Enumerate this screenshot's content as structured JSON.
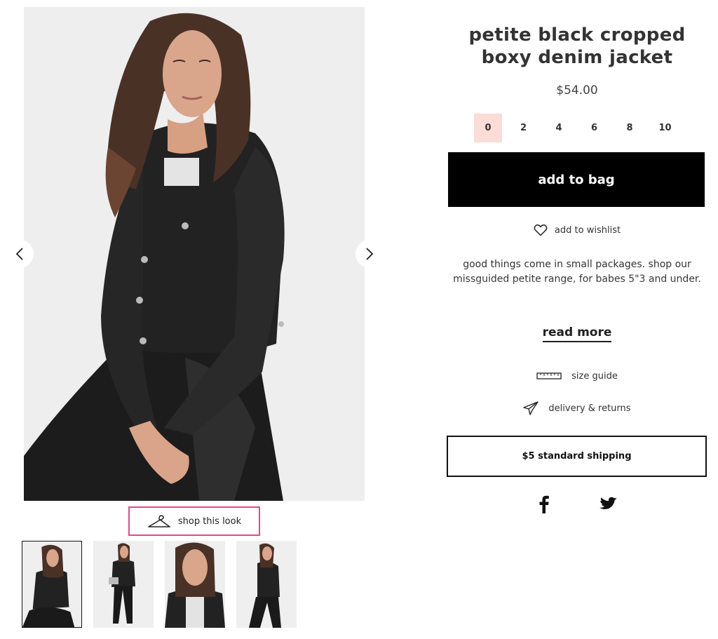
{
  "product": {
    "title_line1": "petite black cropped",
    "title_line2": "boxy denim jacket",
    "price": "$54.00",
    "sizes": [
      "0",
      "2",
      "4",
      "6",
      "8",
      "10"
    ],
    "selected_size": "0",
    "add_to_bag_label": "add to bag",
    "wishlist_label": "add to wishlist",
    "description": "good things come in small packages. shop our missguided petite range, for babes 5\"3 and under.",
    "read_more_label": "read more",
    "size_guide_label": "size guide",
    "delivery_label": "delivery & returns",
    "shipping_label": "$5 standard shipping"
  },
  "gallery": {
    "shop_the_look_label": "shop this look",
    "thumbnail_count": 4,
    "active_thumbnail": 1
  },
  "social": [
    "facebook-icon",
    "twitter-icon"
  ],
  "colors": {
    "selected_size_bg": "#fcdcd6",
    "shop_look_border": "#e8468c",
    "button_bg": "#000000"
  }
}
